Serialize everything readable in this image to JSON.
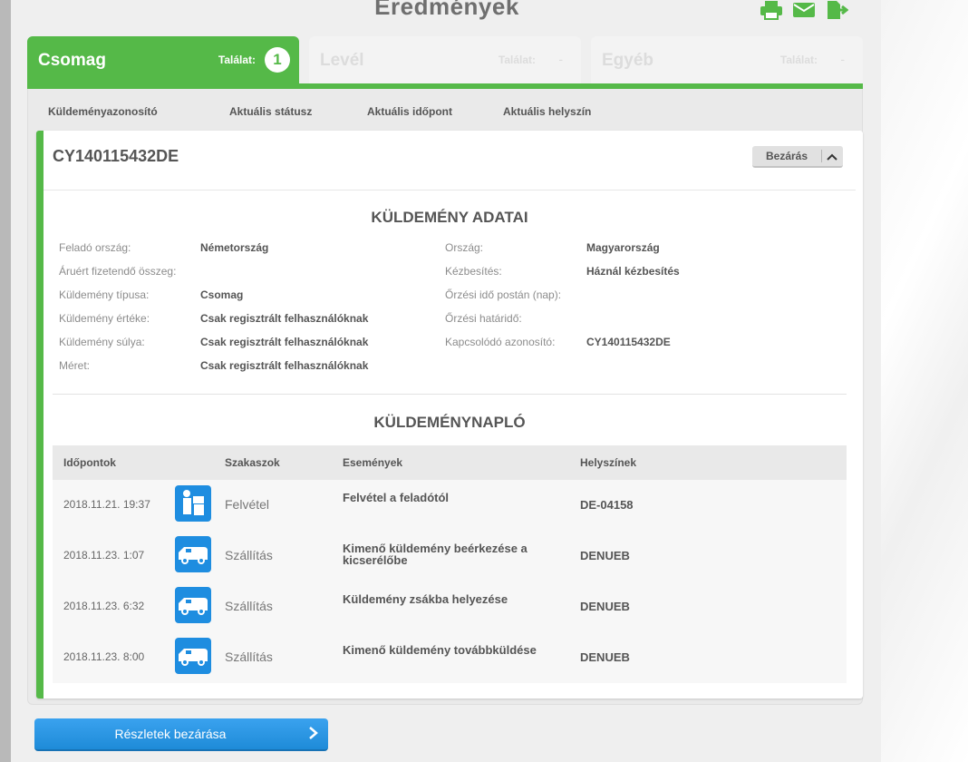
{
  "page_title": "Eredmények",
  "colors": {
    "green": "#55b948",
    "blue": "#1e8de0"
  },
  "tools": [
    {
      "icon": "print-icon"
    },
    {
      "icon": "mail-icon"
    },
    {
      "icon": "export-icon"
    }
  ],
  "tabs": [
    {
      "name": "Csomag",
      "hits_label": "Találat:",
      "count": "1"
    },
    {
      "name": "Levél",
      "hits_label": "Találat:",
      "count": "-"
    },
    {
      "name": "Egyéb",
      "hits_label": "Találat:",
      "count": "-"
    }
  ],
  "columns": [
    "Küldeményazonosító",
    "Aktuális státusz",
    "Aktuális időpont",
    "Aktuális helyszín"
  ],
  "card": {
    "id": "CY140115432DE",
    "close_label": "Bezárás",
    "details_title": "KÜLDEMÉNY ADATAI",
    "left": [
      {
        "label": "Feladó ország:",
        "value": "Németország"
      },
      {
        "label": "Áruért fizetendő összeg:",
        "value": ""
      },
      {
        "label": "Küldemény típusa:",
        "value": "Csomag"
      },
      {
        "label": "Küldemény értéke:",
        "value": "Csak regisztrált felhasználóknak"
      },
      {
        "label": "Küldemény súlya:",
        "value": "Csak regisztrált felhasználóknak"
      },
      {
        "label": "Méret:",
        "value": "Csak regisztrált felhasználóknak"
      }
    ],
    "right": [
      {
        "label": "Ország:",
        "value": "Magyarország"
      },
      {
        "label": "Kézbesítés:",
        "value": "Háznál kézbesítés"
      },
      {
        "label": "Őrzési idő postán (nap):",
        "value": ""
      },
      {
        "label": "Őrzési határidő:",
        "value": ""
      },
      {
        "label": "Kapcsolódó azonosító:",
        "value": "CY140115432DE"
      }
    ],
    "log_title": "KÜLDEMÉNYNAPLÓ",
    "log_headers": [
      "Időpontok",
      "Szakaszok",
      "Események",
      "Helyszínek"
    ],
    "log": [
      {
        "time": "2018.11.21. 19:37",
        "icon": "pickup-icon",
        "stage": "Felvétel",
        "event": "Felvétel a feladótól",
        "location": "DE-04158"
      },
      {
        "time": "2018.11.23. 1:07",
        "icon": "van-icon",
        "stage": "Szállítás",
        "event": "Kimenő küldemény beérkezése a kicserélőbe",
        "location": "DENUEB"
      },
      {
        "time": "2018.11.23. 6:32",
        "icon": "van-icon",
        "stage": "Szállítás",
        "event": "Küldemény zsákba helyezése",
        "location": "DENUEB"
      },
      {
        "time": "2018.11.23. 8:00",
        "icon": "van-icon",
        "stage": "Szállítás",
        "event": "Kimenő küldemény továbbküldése",
        "location": "DENUEB"
      }
    ]
  },
  "bottom_button": "Részletek bezárása"
}
